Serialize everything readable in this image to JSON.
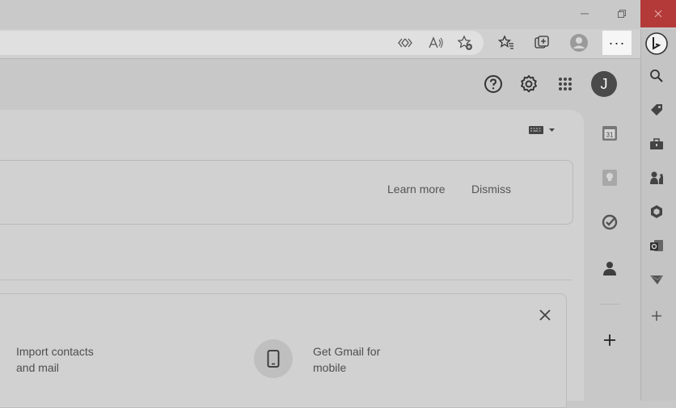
{
  "window": {
    "minimize_icon": "minimize-icon",
    "restore_icon": "restore-icon",
    "close_icon": "close-icon"
  },
  "browser_toolbar": {
    "more_label": "···",
    "icons": [
      "read-aloud-icon",
      "favorite-add-icon",
      "favorites-icon",
      "collections-icon",
      "profile-icon"
    ]
  },
  "gmail_header": {
    "avatar_initial": "J",
    "icons": [
      "help-icon",
      "settings-icon",
      "apps-grid-icon"
    ]
  },
  "banner": {
    "learn_more": "Learn more",
    "dismiss": "Dismiss"
  },
  "setup": {
    "import_line1": "Import contacts",
    "import_line2": "and mail",
    "mobile_line1": "Get Gmail for",
    "mobile_line2": "mobile"
  },
  "calendar_day": "31",
  "colors": {
    "close_button": "#b43a3a",
    "avatar": "#4a4a4a",
    "more_button_bg": "#f6f6f6"
  }
}
